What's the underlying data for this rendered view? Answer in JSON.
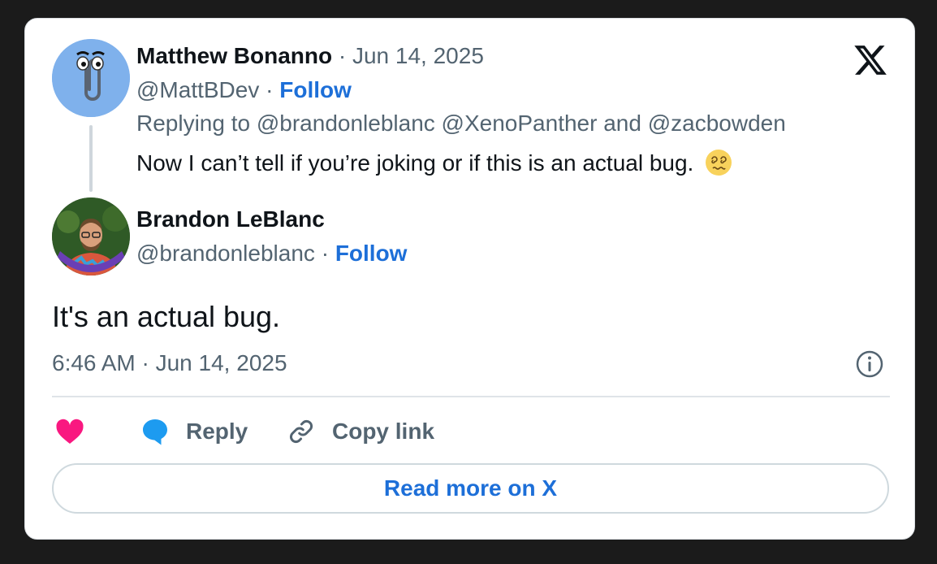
{
  "post1": {
    "author_name": "Matthew Bonanno",
    "date": "Jun 14, 2025",
    "handle": "@MattBDev",
    "follow_label": "Follow",
    "replying_to": "Replying to @brandonleblanc @XenoPanther and @zacbowden",
    "text": "Now I can’t tell if you’re joking or if this is an actual bug.",
    "emoji_icon": "dizzy-face-icon",
    "avatar_icon": "paperclip-clippy-icon"
  },
  "post2": {
    "author_name": "Brandon LeBlanc",
    "handle": "@brandonleblanc",
    "follow_label": "Follow",
    "text": "It's an actual bug.",
    "timestamp": "6:46 AM · Jun 14, 2025"
  },
  "actions": {
    "like_icon": "heart-icon",
    "reply_label": "Reply",
    "copy_label": "Copy link"
  },
  "read_more_label": "Read more on X",
  "separator": "·",
  "colors": {
    "background": "#1b1b1b",
    "card": "#ffffff",
    "link": "#1d6fd8",
    "muted": "#536471",
    "heart": "#f91880",
    "reply_bubble": "#1d9bf0"
  }
}
